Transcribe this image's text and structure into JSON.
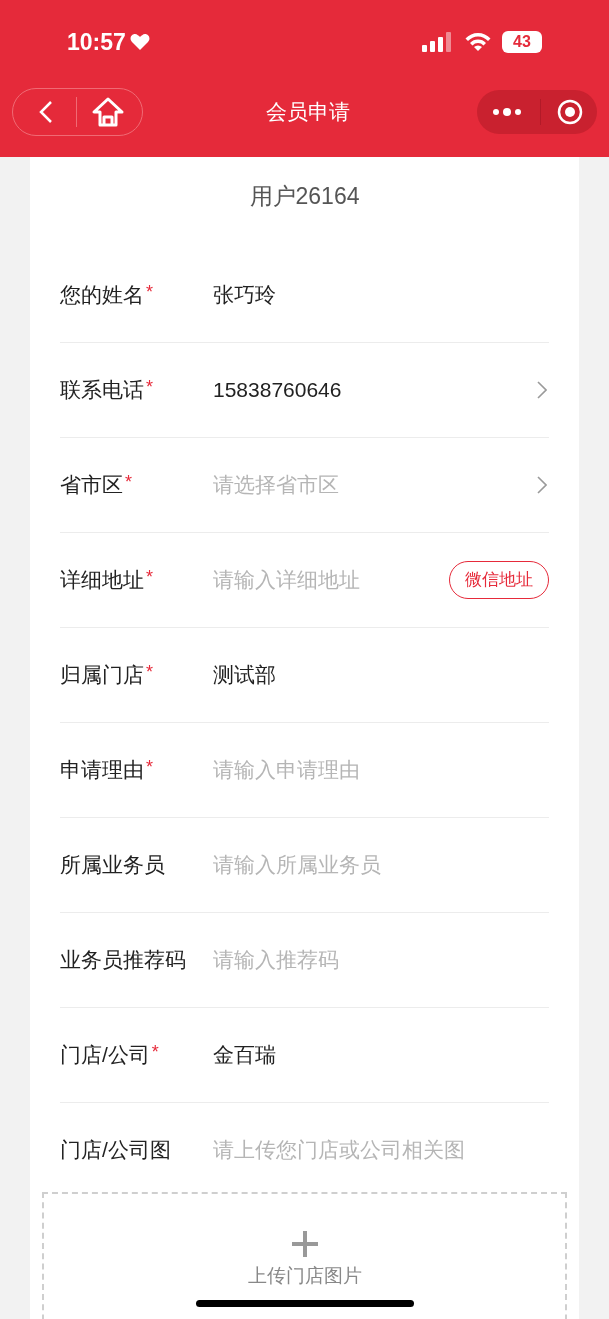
{
  "status_bar": {
    "time": "10:57",
    "battery": "43"
  },
  "nav": {
    "title": "会员申请"
  },
  "form": {
    "user": "用户26164",
    "fields": [
      {
        "label": "您的姓名",
        "mark": "*",
        "value": "张巧玲"
      },
      {
        "label": "联系电话",
        "mark": "*",
        "value": "15838760646",
        "kind": "chevron"
      },
      {
        "label": "省市区",
        "mark": "*",
        "placeholder": "请选择省市区",
        "kind": "chevron"
      },
      {
        "label": "详细地址",
        "mark": "*",
        "placeholder": "请输入详细地址",
        "kind": "button",
        "button": "微信地址"
      },
      {
        "label": "归属门店",
        "mark": "*",
        "value": "测试部"
      },
      {
        "label": "申请理由",
        "mark": "*",
        "placeholder": "请输入申请理由"
      },
      {
        "label": "所属业务员",
        "placeholder": "请输入所属业务员"
      },
      {
        "label": "业务员推荐码",
        "placeholder": "请输入推荐码"
      },
      {
        "label": "门店/公司",
        "mark": "*",
        "value": "金百瑞"
      },
      {
        "label": "门店/公司图",
        "placeholder": "请上传您门店或公司相关图"
      }
    ],
    "upload": {
      "label": "上传门店图片"
    }
  }
}
